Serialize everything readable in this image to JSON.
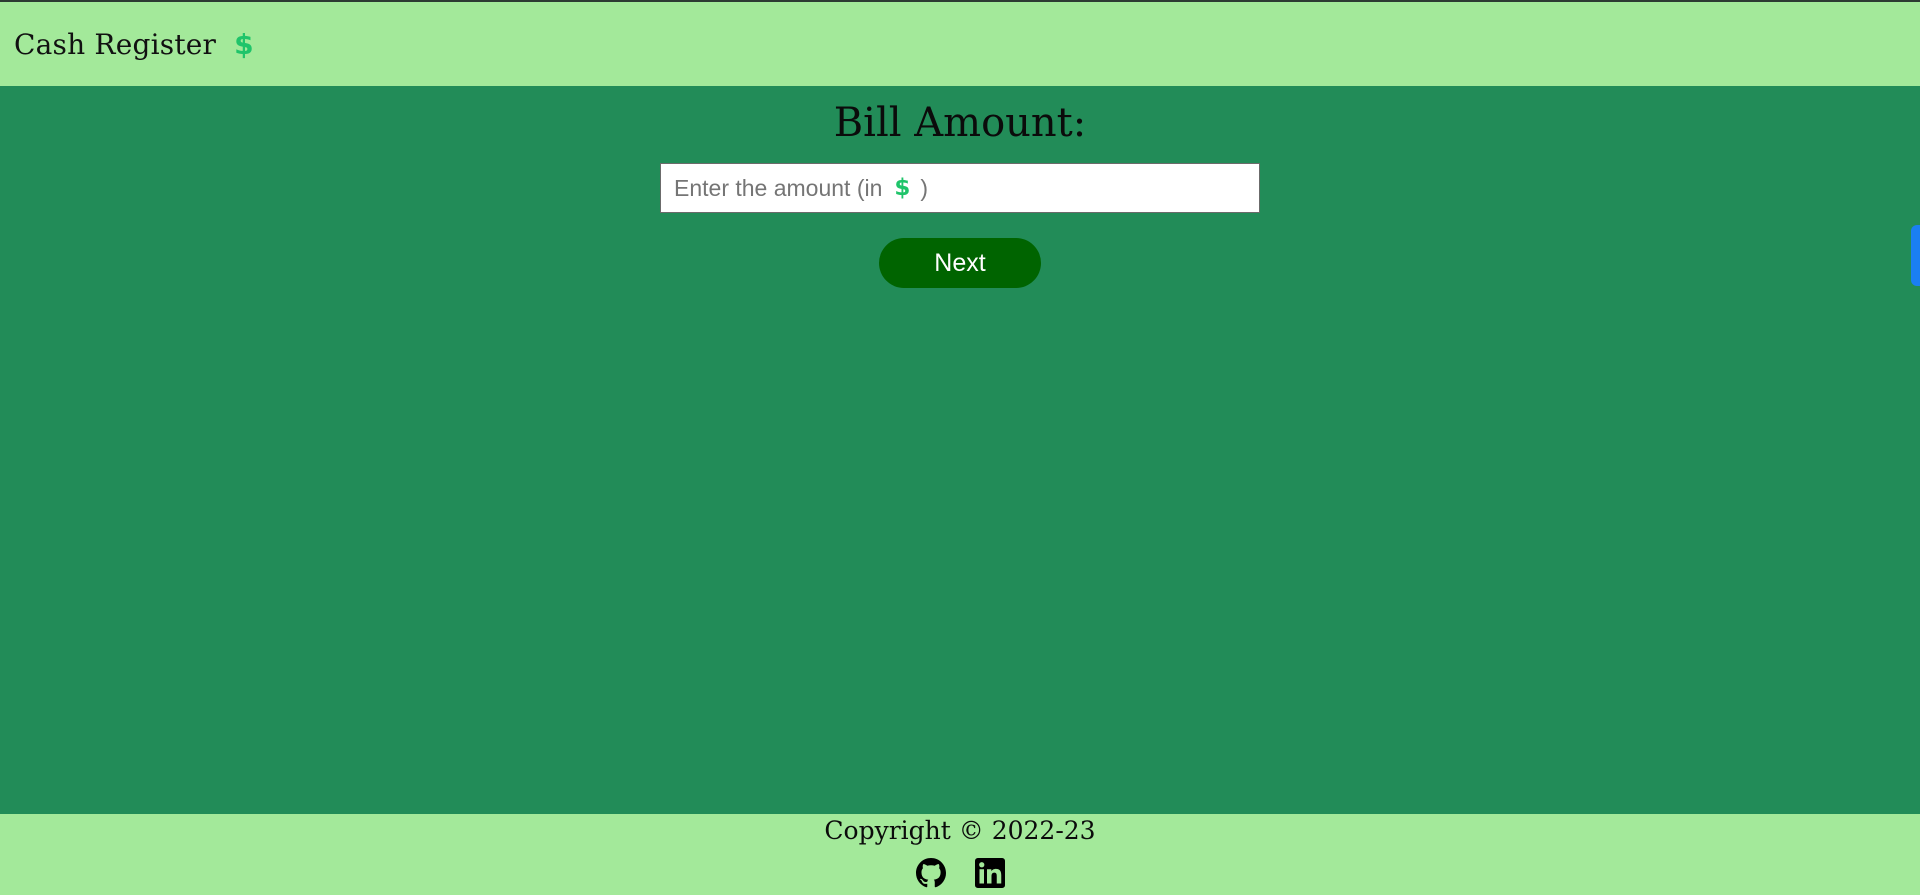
{
  "header": {
    "title": "Cash Register",
    "title_icon": "dollar-icon",
    "title_icon_glyph": "$"
  },
  "main": {
    "heading": "Bill Amount:",
    "input": {
      "placeholder_prefix": "Enter the amount (in",
      "placeholder_icon_glyph": "$",
      "placeholder_suffix": ")",
      "value": ""
    },
    "next_label": "Next"
  },
  "footer": {
    "copyright": "Copyright © 2022-23",
    "links": [
      {
        "icon": "github-icon"
      },
      {
        "icon": "linkedin-icon"
      }
    ]
  },
  "colors": {
    "header_bg": "#a3e99a",
    "main_bg": "#228c58",
    "button_bg": "#006400",
    "accent_dollar": "#1fc46a",
    "side_tab": "#1a7ff2"
  }
}
